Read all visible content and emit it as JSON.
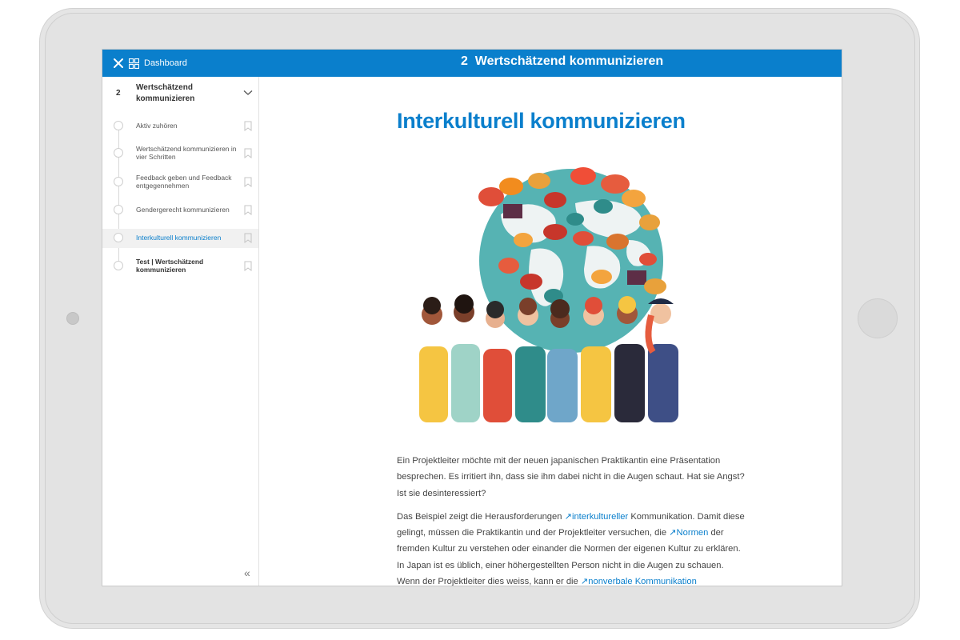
{
  "topbar": {
    "dashboard_label": "Dashboard",
    "chapter_number": "2",
    "title": "Wertschätzend kommunizieren"
  },
  "sidebar": {
    "chapter_number": "2",
    "chapter_title": "Wertschätzend kommunizieren",
    "items": [
      {
        "label": "Aktiv zuhören"
      },
      {
        "label": "Wertschätzend kommunizieren in vier Schritten"
      },
      {
        "label": "Feedback geben und Feedback entgegennehmen"
      },
      {
        "label": "Gendergerecht kommunizieren"
      },
      {
        "label": "Interkulturell kommunizieren"
      },
      {
        "label": "Test | Wertschätzend kommunizieren"
      }
    ],
    "active_index": 4,
    "collapse_glyph": "«"
  },
  "main": {
    "heading": "Interkulturell kommunizieren",
    "paragraph1": "Ein Projektleiter möchte mit der neuen japanischen Praktikantin eine Präsentation besprechen. Es irritiert ihn, dass sie ihm dabei nicht in die Augen schaut. Hat sie Angst? Ist sie desinteressiert?",
    "p2_a": "Das Beispiel zeigt die Herausforderungen ",
    "p2_link1": "↗interkultureller",
    "p2_b": " Kommunikation. Damit diese gelingt, müssen die Praktikantin und der Projektleiter versuchen, die ",
    "p2_link2": "↗Normen",
    "p2_c": " der fremden Kultur zu verstehen oder einander die Normen der eigenen Kultur zu erklären. In Japan ist es üblich, einer höhergestellten Person nicht in die Augen zu schauen. Wenn der Projektleiter dies weiss, kann er die ",
    "p2_link3": "↗nonverbale Kommunikation"
  },
  "colors": {
    "brand_blue": "#0a7fcc",
    "globe": "#56b3b3",
    "land": "#eef3f3"
  },
  "icons": [
    "close-icon",
    "dashboard-grid-icon",
    "chevron-down-icon",
    "bookmark-icon",
    "double-chevron-left-icon"
  ]
}
